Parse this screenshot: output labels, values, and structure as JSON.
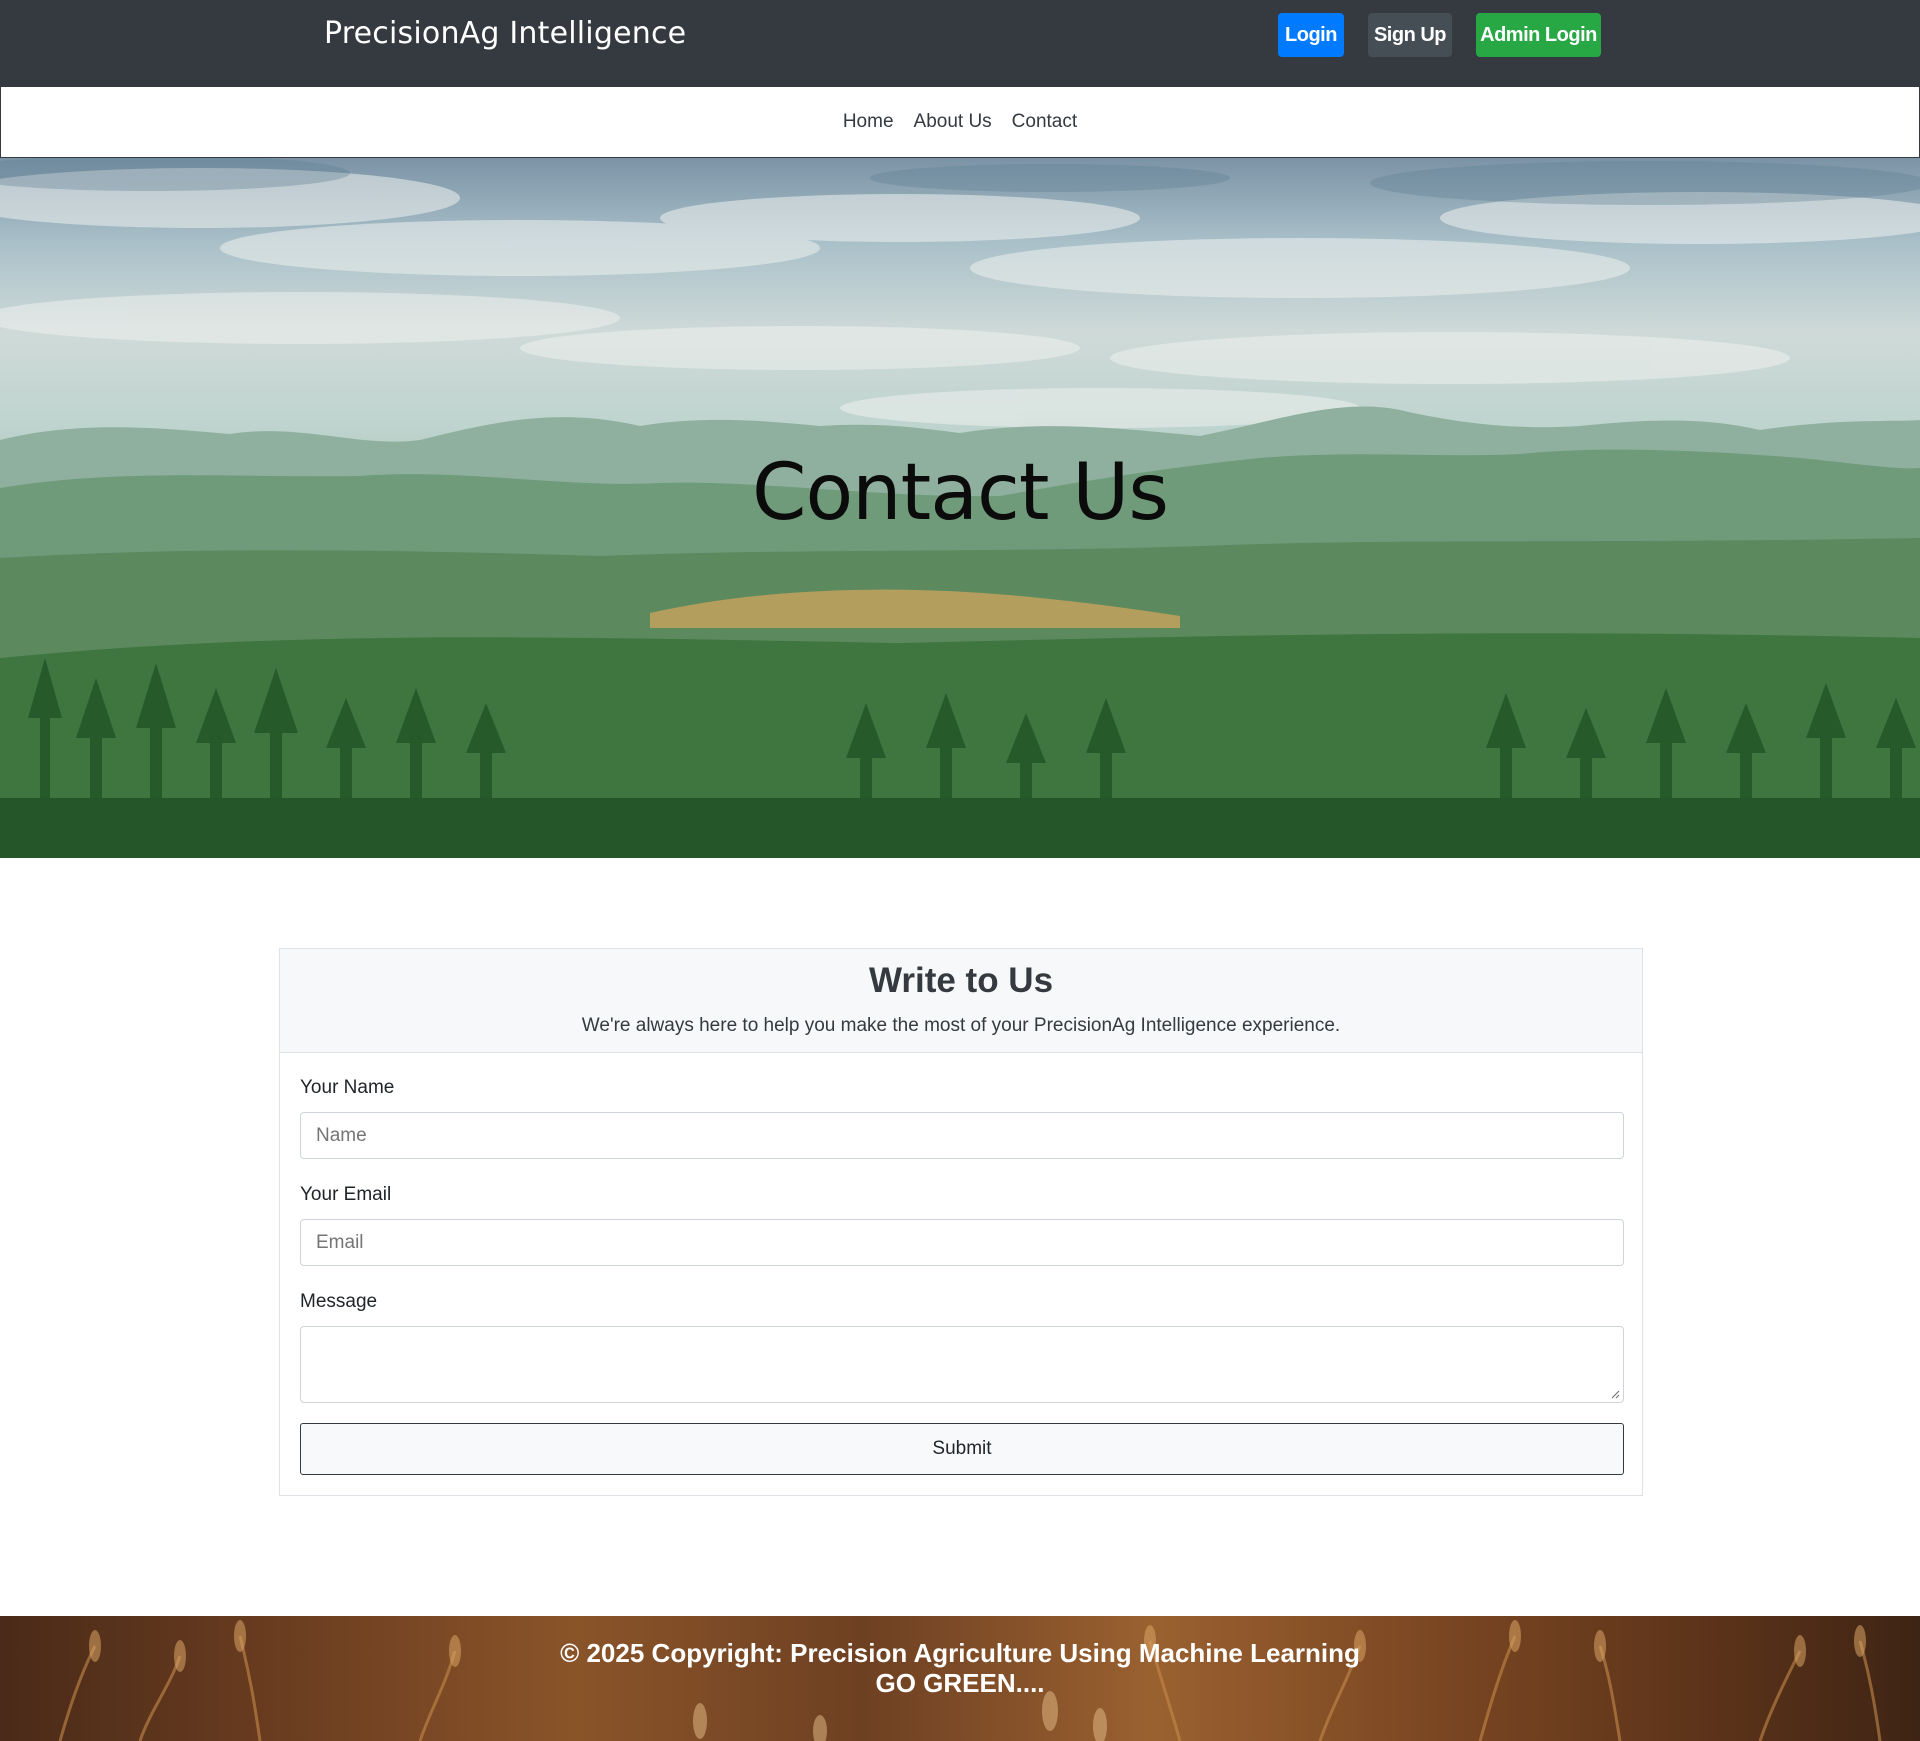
{
  "header": {
    "brand": "PrecisionAg Intelligence",
    "login_label": "Login",
    "signup_label": "Sign Up",
    "admin_login_label": "Admin Login"
  },
  "nav": {
    "items": [
      "Home",
      "About Us",
      "Contact"
    ]
  },
  "hero": {
    "title": "Contact Us"
  },
  "form": {
    "title": "Write to Us",
    "subtitle": "We're always here to help you make the most of your PrecisionAg Intelligence experience.",
    "name_label": "Your Name",
    "name_placeholder": "Name",
    "email_label": "Your Email",
    "email_placeholder": "Email",
    "message_label": "Message",
    "submit_label": "Submit"
  },
  "footer": {
    "copyright": "© 2025 Copyright: Precision Agriculture Using Machine Learning",
    "tagline": "GO GREEN...."
  },
  "colors": {
    "topbar": "#343a40",
    "login": "#007bff",
    "signup": "#454d55",
    "admin_login": "#28a745"
  },
  "icons": {
    "textarea_resize": "resize-grip-icon"
  }
}
